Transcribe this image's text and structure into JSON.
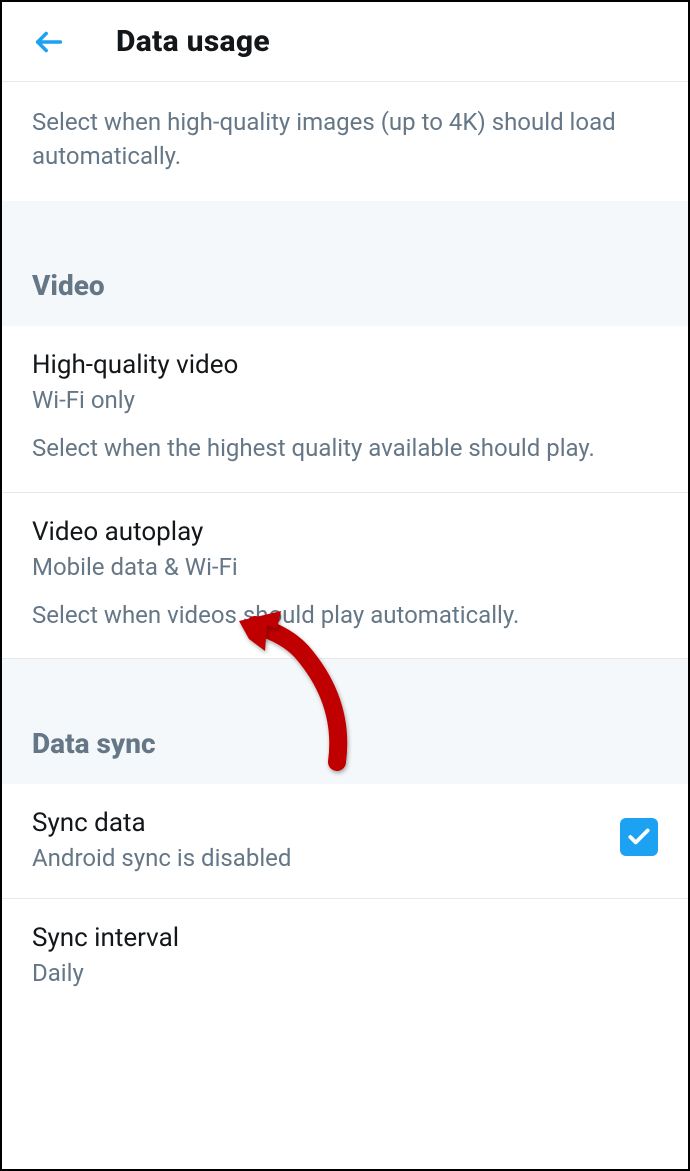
{
  "header": {
    "title": "Data usage"
  },
  "topDescription": "Select when high-quality images (up to 4K) should load automatically.",
  "sections": {
    "video": {
      "label": "Video",
      "items": [
        {
          "title": "High-quality video",
          "value": "Wi-Fi only",
          "description": "Select when the highest quality available should play."
        },
        {
          "title": "Video autoplay",
          "value": "Mobile data & Wi-Fi",
          "description": "Select when videos should play automatically."
        }
      ]
    },
    "dataSync": {
      "label": "Data sync",
      "items": [
        {
          "title": "Sync data",
          "value": "Android sync is disabled",
          "checked": true
        },
        {
          "title": "Sync interval",
          "value": "Daily"
        }
      ]
    }
  }
}
